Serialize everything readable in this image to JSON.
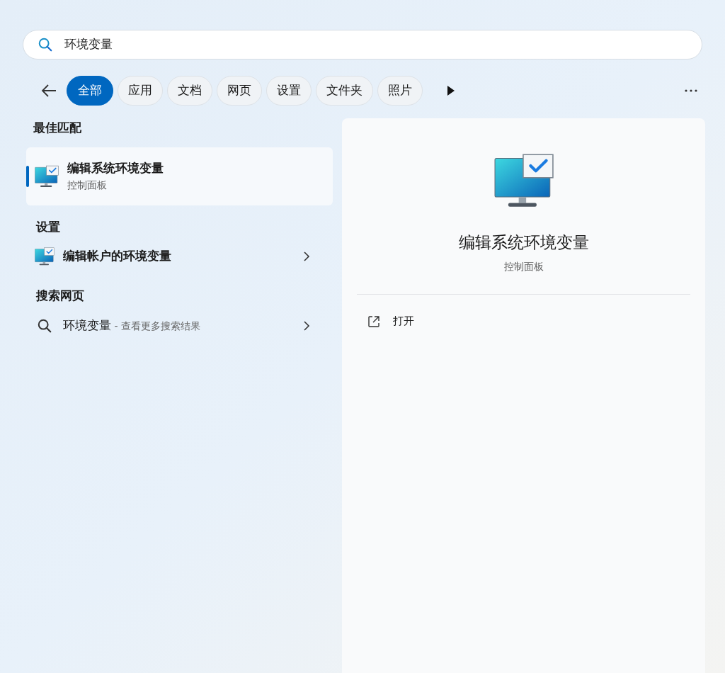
{
  "search": {
    "value": "环境变量"
  },
  "filters": [
    {
      "label": "全部",
      "selected": true
    },
    {
      "label": "应用",
      "selected": false
    },
    {
      "label": "文档",
      "selected": false
    },
    {
      "label": "网页",
      "selected": false
    },
    {
      "label": "设置",
      "selected": false
    },
    {
      "label": "文件夹",
      "selected": false
    },
    {
      "label": "照片",
      "selected": false
    }
  ],
  "sections": [
    {
      "heading": "最佳匹配",
      "items": [
        {
          "kind": "app",
          "title": "编辑系统环境变量",
          "subtitle": "控制面板",
          "selected": true,
          "chevron": false
        }
      ]
    },
    {
      "heading": "设置",
      "items": [
        {
          "kind": "app",
          "title": "编辑帐户的环境变量",
          "selected": false,
          "chevron": true
        }
      ]
    },
    {
      "heading": "搜索网页",
      "items": [
        {
          "kind": "web",
          "title": "环境变量",
          "hint": " - 查看更多搜索结果",
          "selected": false,
          "chevron": true
        }
      ]
    }
  ],
  "detail": {
    "title": "编辑系统环境变量",
    "subtitle": "控制面板",
    "actions": [
      {
        "label": "打开"
      }
    ]
  }
}
